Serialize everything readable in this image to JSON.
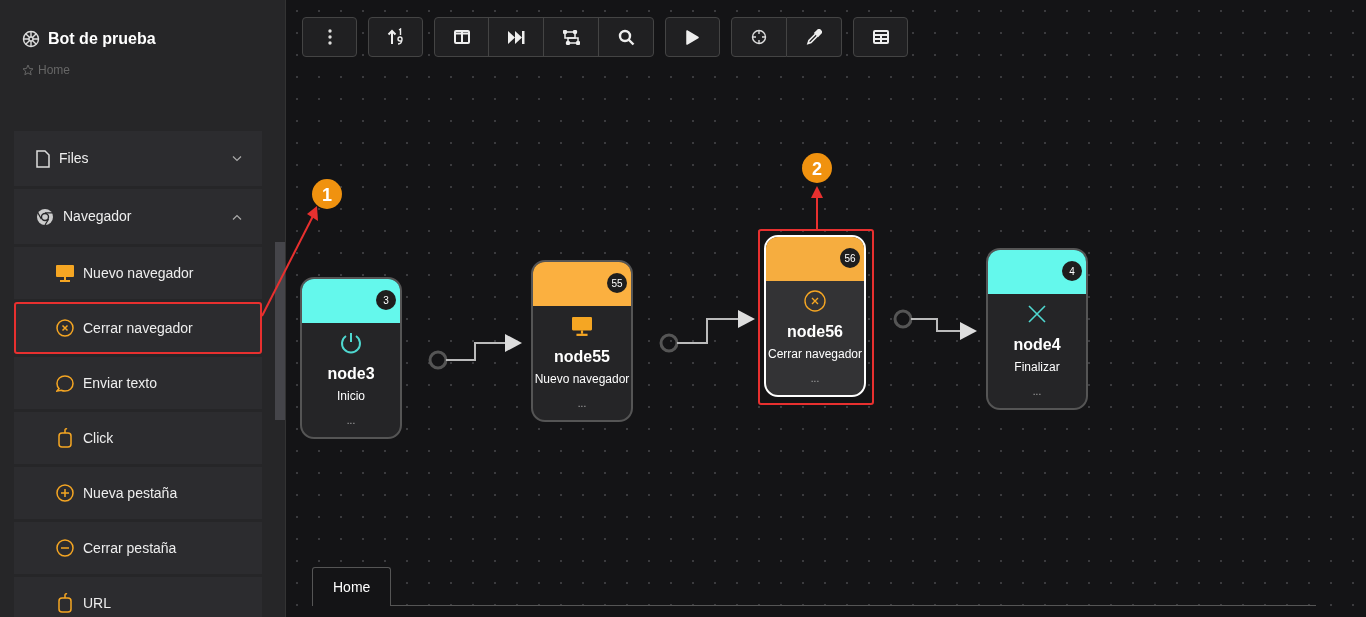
{
  "sidebar": {
    "title": "Bot de prueba",
    "breadcrumb": "Home",
    "groups": [
      {
        "label": "Files",
        "expanded": false
      },
      {
        "label": "Navegador",
        "expanded": true,
        "items": [
          {
            "label": "Nuevo navegador",
            "highlighted": false
          },
          {
            "label": "Cerrar navegador",
            "highlighted": true
          },
          {
            "label": "Enviar texto",
            "highlighted": false
          },
          {
            "label": "Click",
            "highlighted": false
          },
          {
            "label": "Nueva pestaña",
            "highlighted": false
          },
          {
            "label": "Cerrar pestaña",
            "highlighted": false
          },
          {
            "label": "URL",
            "highlighted": false
          }
        ]
      }
    ]
  },
  "canvas": {
    "nodes": [
      {
        "title": "node3",
        "subtitle": "Inicio",
        "badge": "3",
        "footer": "...",
        "color": "#64f8ec",
        "selected": false,
        "highlighted": false
      },
      {
        "title": "node55",
        "subtitle": "Nuevo navegador",
        "badge": "55",
        "footer": "...",
        "color": "#fbb040",
        "selected": false,
        "highlighted": false
      },
      {
        "title": "node56",
        "subtitle": "Cerrar navegador",
        "badge": "56",
        "footer": "...",
        "color": "#f6ad3f",
        "selected": true,
        "highlighted": true
      },
      {
        "title": "node4",
        "subtitle": "Finalizar",
        "badge": "4",
        "footer": "...",
        "color": "#64f8ec",
        "selected": false,
        "highlighted": false
      }
    ],
    "annotations": [
      {
        "label": "1"
      },
      {
        "label": "2"
      }
    ]
  },
  "tabs": [
    {
      "label": "Home",
      "selected": true
    }
  ]
}
